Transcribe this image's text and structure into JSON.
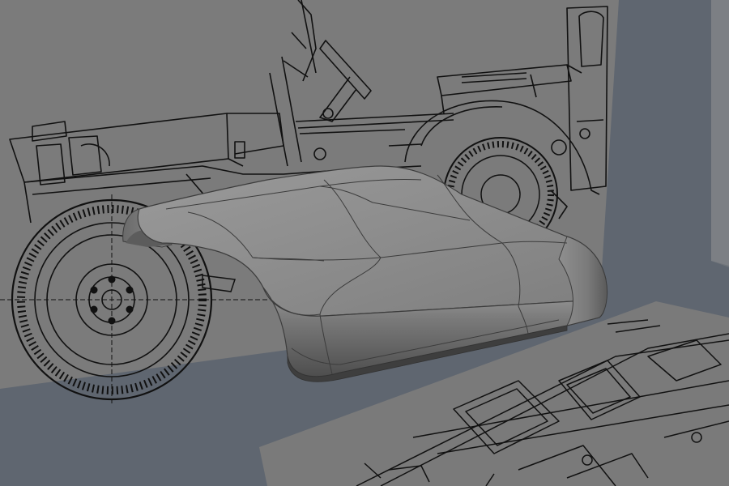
{
  "scene": {
    "background_color": "#5f6670",
    "side_plane_color": "#6d7278",
    "blueprint_plane_color": "#7c7c7c",
    "blueprint_line_color": "#111111",
    "floor_plane_color": "#7a7a7a",
    "model_base_color": "#8a8a8a",
    "model_highlight_color": "#a3a3a3",
    "model_shadow_color": "#4e4e4e",
    "wireframe_color": "#3c3c3c"
  }
}
